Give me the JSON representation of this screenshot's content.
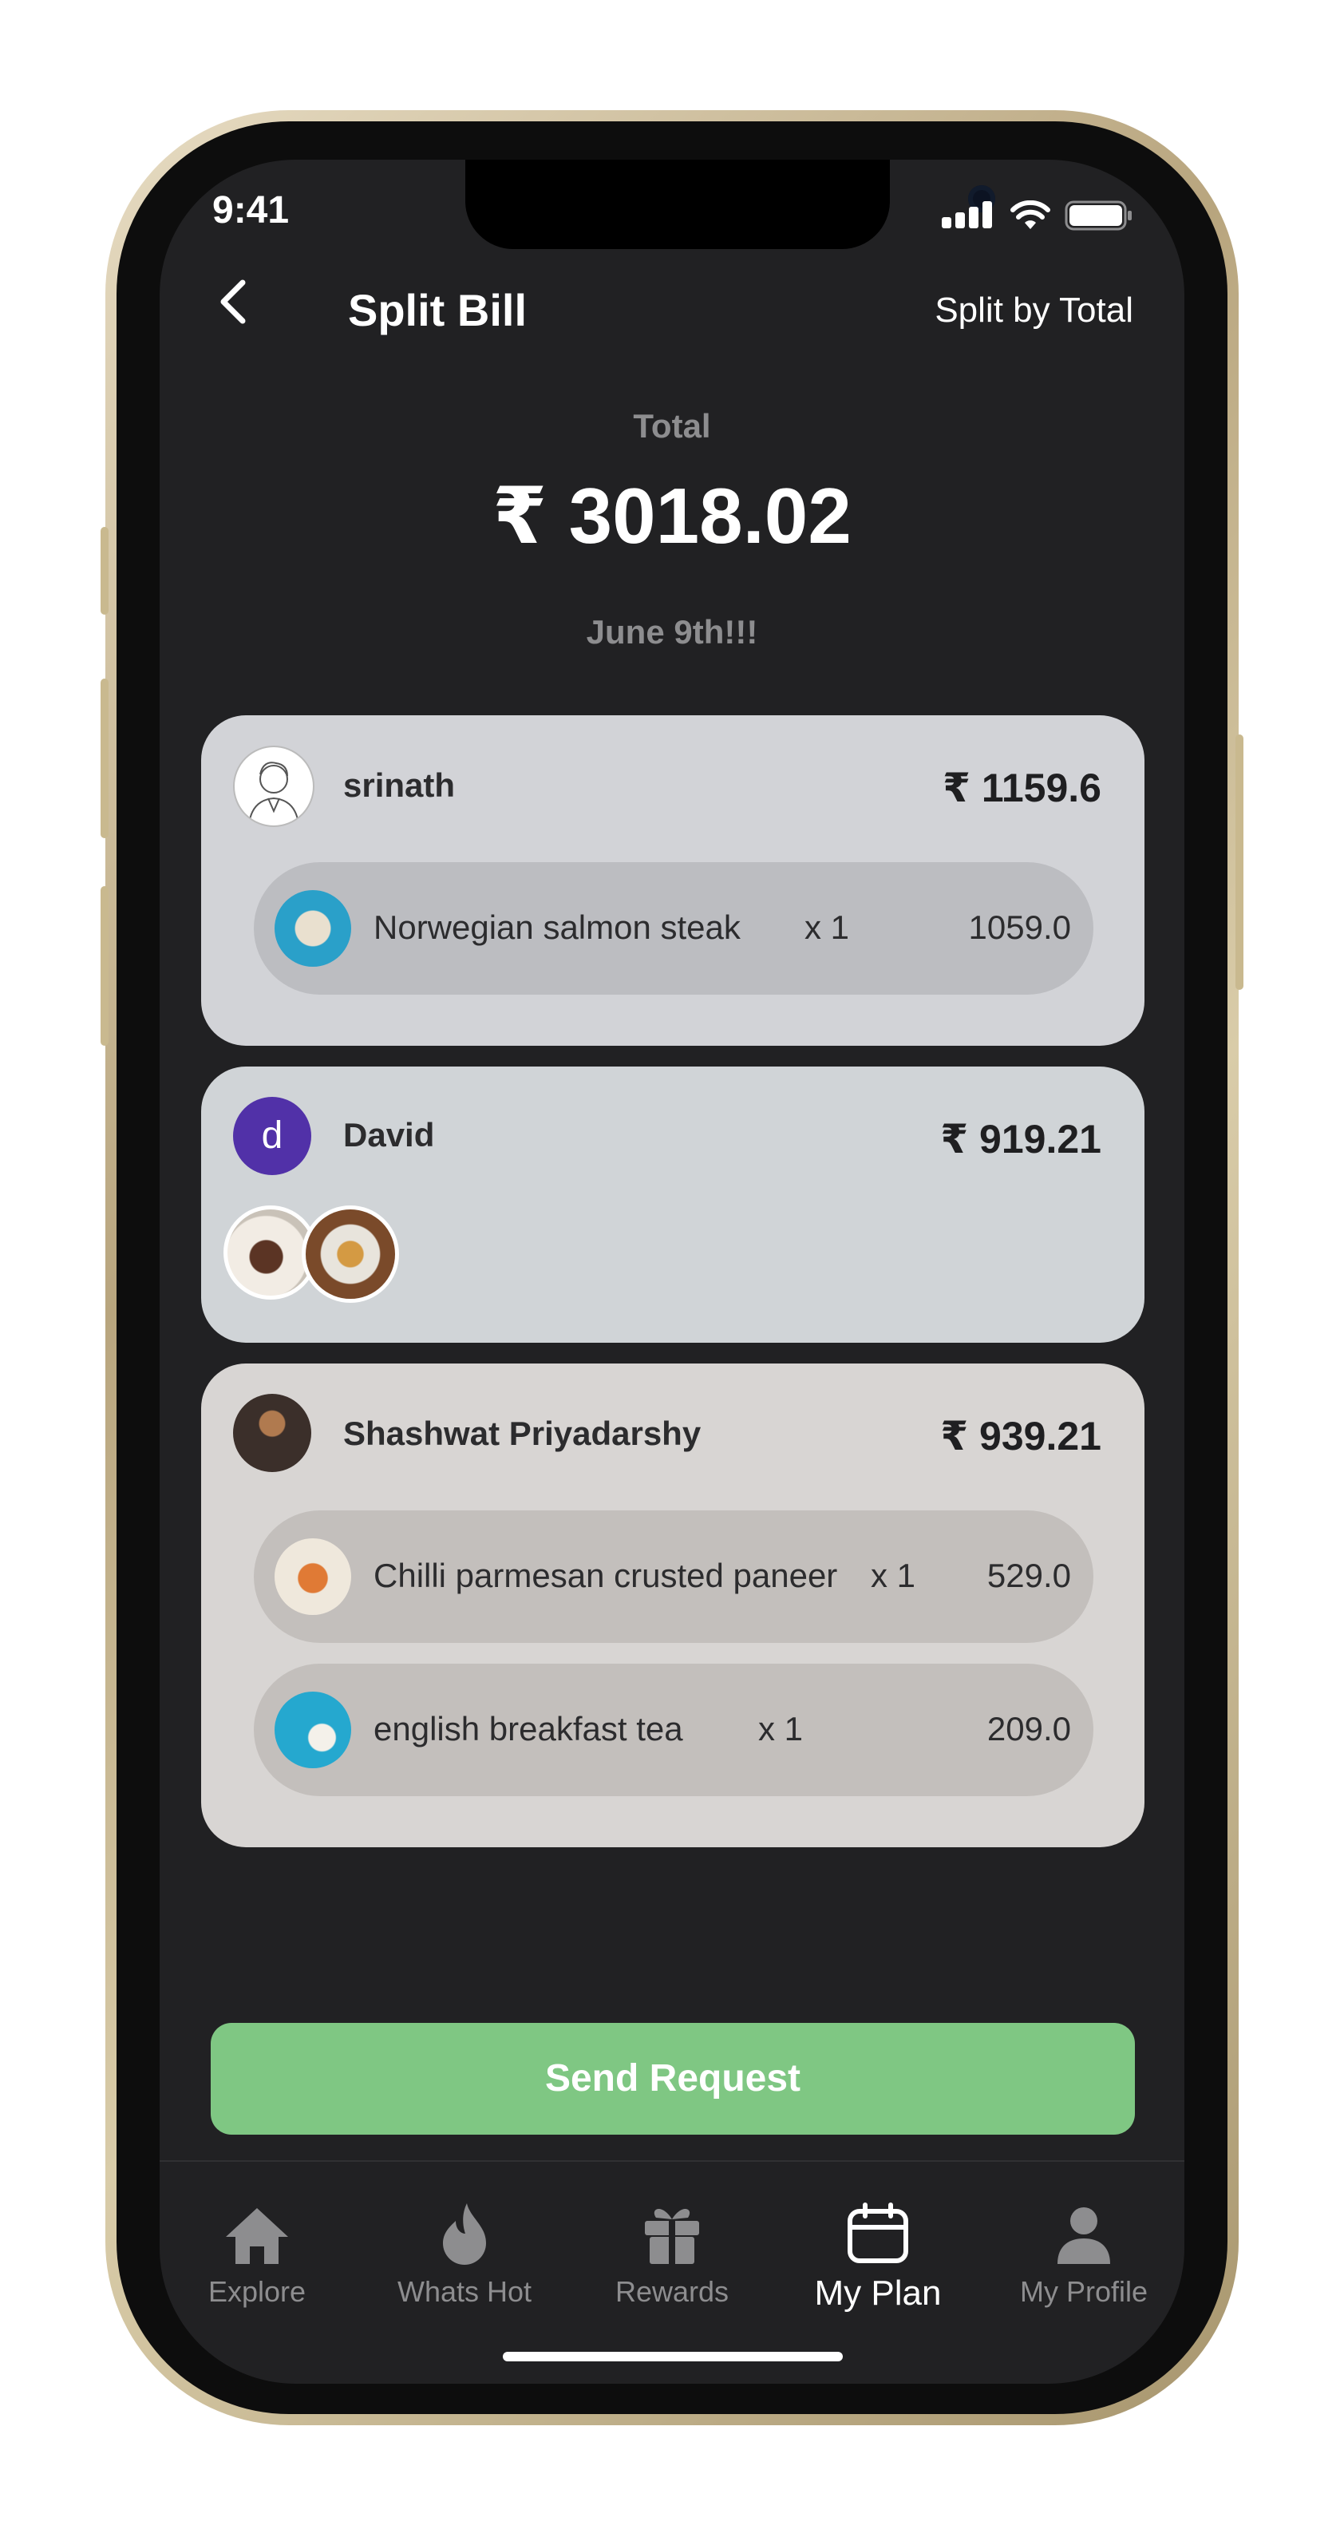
{
  "status_bar": {
    "time": "9:41"
  },
  "header": {
    "title": "Split Bill",
    "split_mode": "Split by Total"
  },
  "summary": {
    "total_label": "Total",
    "total_amount": "₹ 3018.02",
    "plan_name": "June 9th!!!"
  },
  "participants": [
    {
      "name": "srinath",
      "amount": "₹ 1159.6",
      "avatar": "sketch-portrait",
      "card_color": "#d2d3d7",
      "items": [
        {
          "name": "Norwegian salmon steak",
          "qty": "x 1",
          "price": "1059.0",
          "thumb": "salmon-dish"
        }
      ]
    },
    {
      "name": "David",
      "amount": "₹ 919.21",
      "avatar_initial": "d",
      "avatar_color": "#5131a8",
      "card_color": "#d0d4d7",
      "item_thumbs": [
        "cake-slice",
        "burger-platter"
      ]
    },
    {
      "name": "Shashwat Priyadarshy",
      "amount": "₹ 939.21",
      "avatar": "photo-portrait",
      "card_color": "#d8d5d3",
      "items": [
        {
          "name": "Chilli parmesan crusted paneer",
          "qty": "x 1",
          "price": "529.0",
          "thumb": "paneer-dish"
        },
        {
          "name": "english breakfast tea",
          "qty": "x 1",
          "price": "209.0",
          "thumb": "tea-cup"
        }
      ]
    }
  ],
  "actions": {
    "send_request": "Send Request"
  },
  "tabs": [
    {
      "label": "Explore",
      "icon": "home-icon"
    },
    {
      "label": "Whats Hot",
      "icon": "flame-icon"
    },
    {
      "label": "Rewards",
      "icon": "gift-icon"
    },
    {
      "label": "My Plan",
      "icon": "calendar-icon",
      "active": true
    },
    {
      "label": "My Profile",
      "icon": "person-icon"
    }
  ],
  "colors": {
    "accent_green": "#7fc783",
    "screen_bg": "#212123"
  }
}
